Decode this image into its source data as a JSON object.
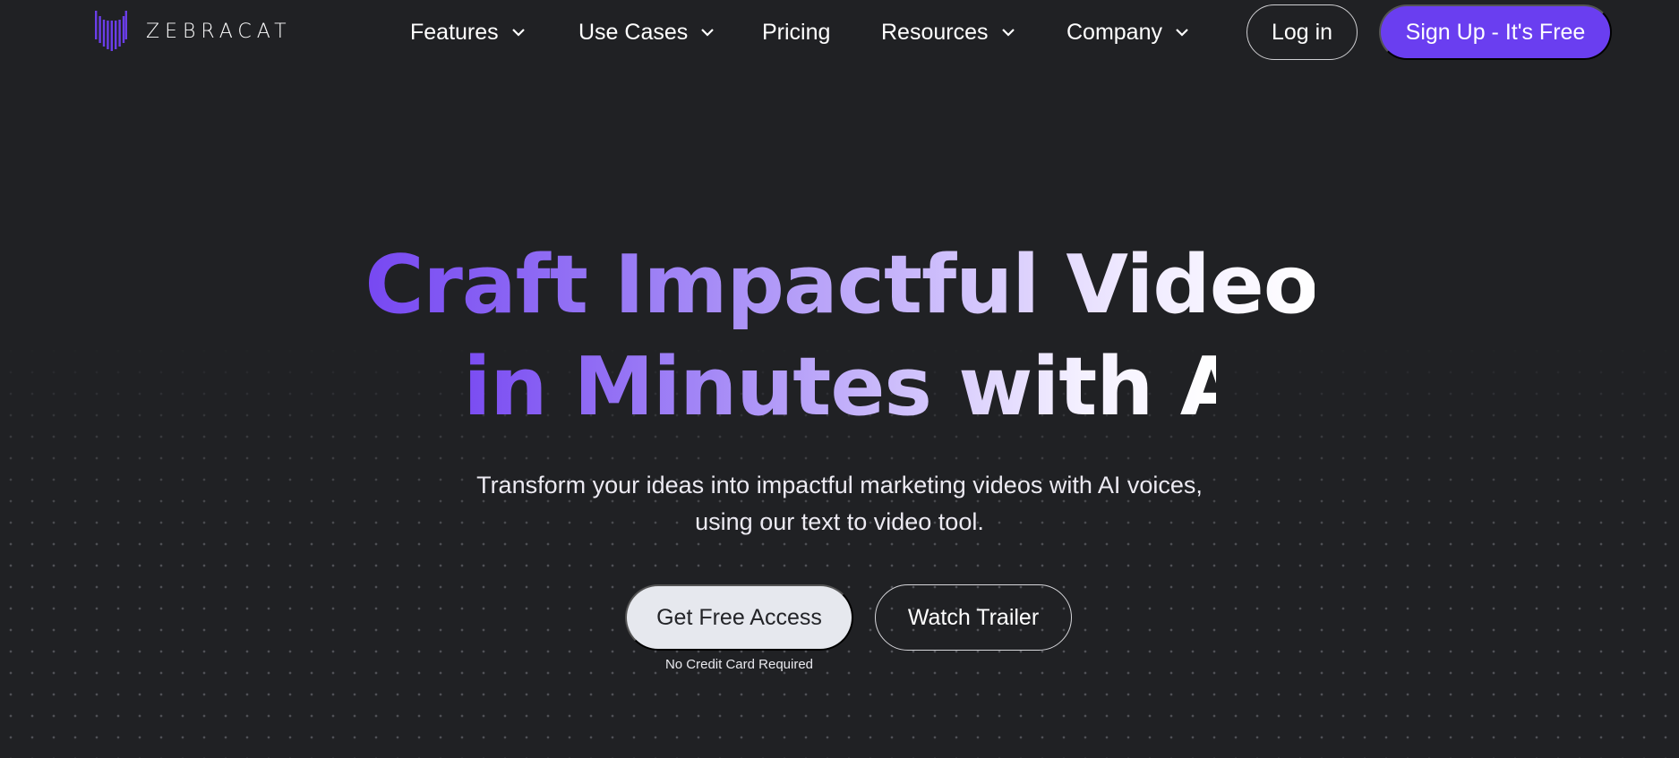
{
  "brand": {
    "name": "ZEBRACAT",
    "logo_icon": "zebracat-logo-icon",
    "accent_color": "#6a3ef0"
  },
  "nav": {
    "items": [
      {
        "label": "Features",
        "has_dropdown": true,
        "icon": "chevron-down-icon"
      },
      {
        "label": "Use Cases",
        "has_dropdown": true,
        "icon": "chevron-down-icon"
      },
      {
        "label": "Pricing",
        "has_dropdown": false
      },
      {
        "label": "Resources",
        "has_dropdown": true,
        "icon": "chevron-down-icon"
      },
      {
        "label": "Company",
        "has_dropdown": true,
        "icon": "chevron-down-icon"
      }
    ],
    "login_label": "Log in",
    "signup_label": "Sign Up - It's Free"
  },
  "hero": {
    "headline_line1": "Craft Impactful Videos",
    "headline_line2": "in Minutes with AI",
    "subheading_line1": "Transform your ideas into impactful marketing videos with AI voices,",
    "subheading_line2": "using our text to video tool.",
    "primary_cta": "Get Free Access",
    "secondary_cta": "Watch Trailer",
    "cta_note": "No Credit Card Required",
    "gradient_start": "#7748f2",
    "gradient_end": "#ffffff"
  }
}
